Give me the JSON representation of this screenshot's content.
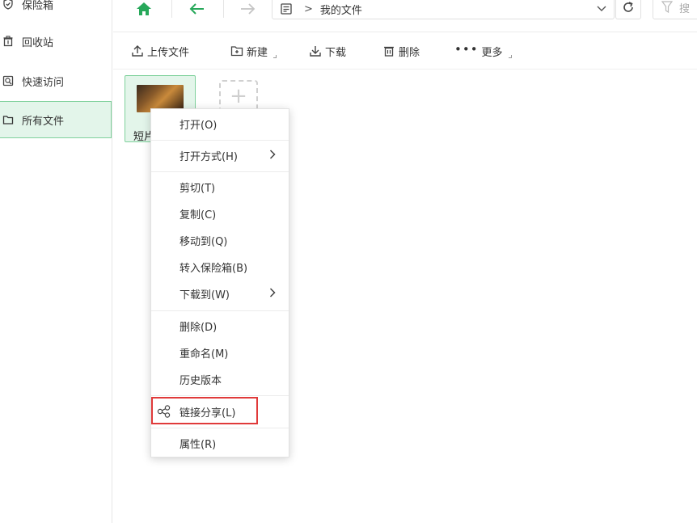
{
  "sidebar": {
    "items": [
      {
        "label": "保险箱",
        "icon": "shield-icon"
      },
      {
        "label": "回收站",
        "icon": "trash-icon"
      },
      {
        "label": "快速访问",
        "icon": "quick-access-icon"
      },
      {
        "label": "所有文件",
        "icon": "folder-icon",
        "active": true
      }
    ]
  },
  "topbar": {
    "breadcrumb": ">",
    "current_folder": "我的文件",
    "search_placeholder": "搜"
  },
  "toolbar": {
    "upload_label": "上传文件",
    "new_label": "新建",
    "download_label": "下载",
    "delete_label": "删除",
    "more_label": "更多"
  },
  "files": [
    {
      "name": "短片",
      "name_visible": "短片",
      "type": "video-thumbnail"
    }
  ],
  "context_menu": {
    "items": [
      {
        "label": "打开(O)"
      },
      {
        "label": "打开方式(H)",
        "submenu": true
      },
      {
        "label": "剪切(T)"
      },
      {
        "label": "复制(C)"
      },
      {
        "label": "移动到(Q)"
      },
      {
        "label": "转入保险箱(B)"
      },
      {
        "label": "下载到(W)",
        "submenu": true
      },
      {
        "label": "删除(D)"
      },
      {
        "label": "重命名(M)"
      },
      {
        "label": "历史版本"
      },
      {
        "label": "链接分享(L)",
        "icon": "share-icon",
        "highlighted": true
      },
      {
        "label": "属性(R)"
      }
    ]
  },
  "colors": {
    "accent": "#27a85a",
    "selection_bg": "#e3f5ea",
    "selection_border": "#7fd19c",
    "highlight_border": "#e03a3a"
  }
}
